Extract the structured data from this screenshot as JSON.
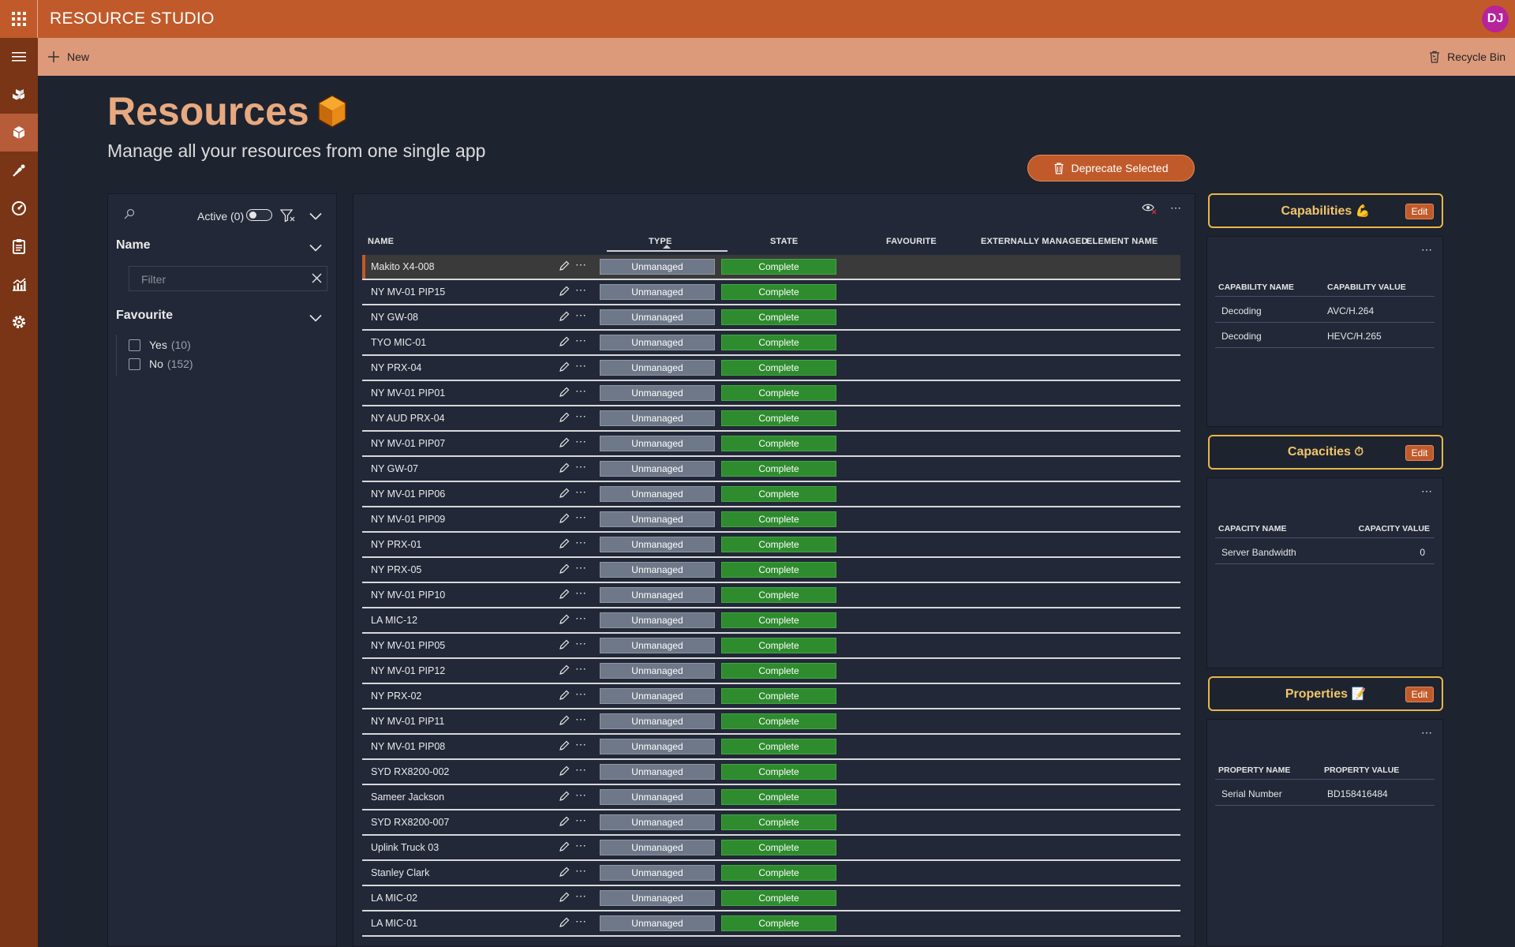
{
  "app": {
    "title": "RESOURCE STUDIO",
    "avatar_initials": "DJ",
    "accent": "#c15a2a"
  },
  "command_bar": {
    "new_label": "New",
    "recycle_label": "Recycle Bin"
  },
  "rail": {
    "items": [
      "apps-icon",
      "resources-icon",
      "pipeline-icon",
      "dashboard-icon",
      "clipboard-icon",
      "chart-icon",
      "settings-icon"
    ]
  },
  "header": {
    "title": "Resources",
    "subtitle": "Manage all your resources from one single app",
    "deprecate_label": "Deprecate Selected"
  },
  "filters": {
    "active_label": "Active (0)",
    "name_section": "Name",
    "filter_placeholder": "Filter",
    "favourite_section": "Favourite",
    "favourite_options": [
      {
        "label": "Yes",
        "count": "(10)"
      },
      {
        "label": "No",
        "count": "(152)"
      }
    ]
  },
  "grid": {
    "columns": [
      "NAME",
      "TYPE",
      "STATE",
      "FAVOURITE",
      "EXTERNALLY MANAGED",
      "ELEMENT NAME"
    ],
    "rows": [
      {
        "name": "Makito X4-008",
        "type": "Unmanaged",
        "state": "Complete"
      },
      {
        "name": "NY MV-01 PIP15",
        "type": "Unmanaged",
        "state": "Complete"
      },
      {
        "name": "NY GW-08",
        "type": "Unmanaged",
        "state": "Complete"
      },
      {
        "name": "TYO MIC-01",
        "type": "Unmanaged",
        "state": "Complete"
      },
      {
        "name": "NY PRX-04",
        "type": "Unmanaged",
        "state": "Complete"
      },
      {
        "name": "NY MV-01 PIP01",
        "type": "Unmanaged",
        "state": "Complete"
      },
      {
        "name": "NY AUD PRX-04",
        "type": "Unmanaged",
        "state": "Complete"
      },
      {
        "name": "NY MV-01 PIP07",
        "type": "Unmanaged",
        "state": "Complete"
      },
      {
        "name": "NY GW-07",
        "type": "Unmanaged",
        "state": "Complete"
      },
      {
        "name": "NY MV-01 PIP06",
        "type": "Unmanaged",
        "state": "Complete"
      },
      {
        "name": "NY MV-01 PIP09",
        "type": "Unmanaged",
        "state": "Complete"
      },
      {
        "name": "NY PRX-01",
        "type": "Unmanaged",
        "state": "Complete"
      },
      {
        "name": "NY PRX-05",
        "type": "Unmanaged",
        "state": "Complete"
      },
      {
        "name": "NY MV-01 PIP10",
        "type": "Unmanaged",
        "state": "Complete"
      },
      {
        "name": "LA MIC-12",
        "type": "Unmanaged",
        "state": "Complete"
      },
      {
        "name": "NY MV-01 PIP05",
        "type": "Unmanaged",
        "state": "Complete"
      },
      {
        "name": "NY MV-01 PIP12",
        "type": "Unmanaged",
        "state": "Complete"
      },
      {
        "name": "NY PRX-02",
        "type": "Unmanaged",
        "state": "Complete"
      },
      {
        "name": "NY MV-01 PIP11",
        "type": "Unmanaged",
        "state": "Complete"
      },
      {
        "name": "NY MV-01 PIP08",
        "type": "Unmanaged",
        "state": "Complete"
      },
      {
        "name": "SYD RX8200-002",
        "type": "Unmanaged",
        "state": "Complete"
      },
      {
        "name": "Sameer Jackson",
        "type": "Unmanaged",
        "state": "Complete"
      },
      {
        "name": "SYD RX8200-007",
        "type": "Unmanaged",
        "state": "Complete"
      },
      {
        "name": "Uplink Truck 03",
        "type": "Unmanaged",
        "state": "Complete"
      },
      {
        "name": "Stanley Clark",
        "type": "Unmanaged",
        "state": "Complete"
      },
      {
        "name": "LA MIC-02",
        "type": "Unmanaged",
        "state": "Complete"
      },
      {
        "name": "LA MIC-01",
        "type": "Unmanaged",
        "state": "Complete"
      }
    ]
  },
  "capabilities": {
    "title": "Capabilities",
    "emoji": "💪",
    "edit_label": "Edit",
    "col_name": "CAPABILITY NAME",
    "col_value": "CAPABILITY VALUE",
    "rows": [
      {
        "name": "Decoding",
        "value": "AVC/H.264"
      },
      {
        "name": "Decoding",
        "value": "HEVC/H.265"
      }
    ]
  },
  "capacities": {
    "title": "Capacities",
    "emoji": "⏱",
    "edit_label": "Edit",
    "col_name": "CAPACITY NAME",
    "col_value": "CAPACITY VALUE",
    "rows": [
      {
        "name": "Server Bandwidth",
        "value": "0"
      }
    ]
  },
  "properties": {
    "title": "Properties",
    "emoji": "📝",
    "edit_label": "Edit",
    "col_name": "PROPERTY NAME",
    "col_value": "PROPERTY VALUE",
    "rows": [
      {
        "name": "Serial Number",
        "value": "BD158416484"
      }
    ]
  }
}
